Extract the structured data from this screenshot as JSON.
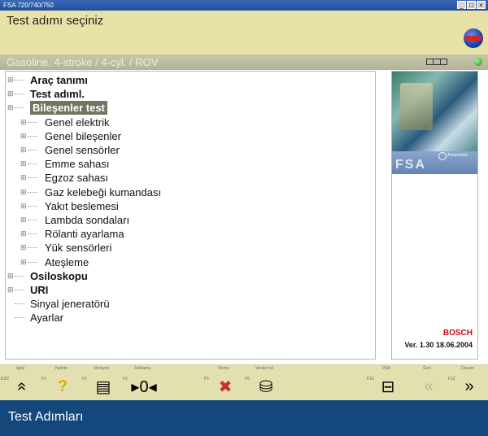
{
  "window": {
    "title": "FSA 720/740/750"
  },
  "header": {
    "title": "Test adımı seçiniz"
  },
  "subheader": {
    "text": "Gasoline, 4-stroke /  4-cyl. / ROV"
  },
  "tree": [
    {
      "label": "Araç tanımı",
      "level": 0,
      "bold": true,
      "expandable": true
    },
    {
      "label": "Test adıml.",
      "level": 0,
      "bold": true,
      "expandable": true
    },
    {
      "label": "Bileşenler test",
      "level": 0,
      "bold": true,
      "expandable": true,
      "selected": true
    },
    {
      "label": "Genel elektrik",
      "level": 1,
      "expandable": true
    },
    {
      "label": "Genel bileşenler",
      "level": 1,
      "expandable": true
    },
    {
      "label": "Genel sensörler",
      "level": 1,
      "expandable": true
    },
    {
      "label": "Emme sahası",
      "level": 1,
      "expandable": true
    },
    {
      "label": "Egzoz sahası",
      "level": 1,
      "expandable": true
    },
    {
      "label": "Gaz kelebeği kumandası",
      "level": 1,
      "expandable": true
    },
    {
      "label": "Yakıt beslemesi",
      "level": 1,
      "expandable": true
    },
    {
      "label": "Lambda sondaları",
      "level": 1,
      "expandable": true
    },
    {
      "label": "Rölanti ayarlama",
      "level": 1,
      "expandable": true
    },
    {
      "label": "Yük sensörleri",
      "level": 1,
      "expandable": true
    },
    {
      "label": "Ateşleme",
      "level": 1,
      "expandable": true
    },
    {
      "label": "Osiloskopu",
      "level": 0,
      "bold": true,
      "expandable": true
    },
    {
      "label": "URI",
      "level": 0,
      "bold": true,
      "expandable": true
    },
    {
      "label": "Sinyal jeneratörü",
      "level": 0,
      "bold": false,
      "expandable": false
    },
    {
      "label": "Ayarlar",
      "level": 0,
      "bold": false,
      "expandable": false
    }
  ],
  "side": {
    "product": "FSA",
    "automotive": "Automotive",
    "brand": "BOSCH",
    "version": "Ver. 1.30 18.06.2004"
  },
  "fkeys": [
    {
      "top": "İptal",
      "f": "ESC",
      "icon": "double-chevron-up-icon",
      "glyph": "«",
      "enabled": true
    },
    {
      "top": "Yardım",
      "f": "F1",
      "icon": "help-question-icon",
      "glyph": "?",
      "enabled": true
    },
    {
      "top": "Versiyon",
      "f": "F2",
      "icon": "document-icon",
      "glyph": "▤",
      "enabled": true
    },
    {
      "top": "Sıfırlama",
      "f": "F3",
      "icon": "reset-zero-icon",
      "glyph": "▸0◂",
      "enabled": true
    },
    {
      "top": "",
      "f": "",
      "icon": "empty",
      "glyph": "",
      "enabled": false
    },
    {
      "top": "Demo",
      "f": "F5",
      "icon": "demo-car-icon",
      "glyph": "✖",
      "enabled": true
    },
    {
      "top": "Verileri sil",
      "f": "F6",
      "icon": "delete-data-icon",
      "glyph": "⛁",
      "enabled": true
    },
    {
      "top": "",
      "f": "",
      "icon": "empty",
      "glyph": "",
      "enabled": false
    },
    {
      "top": "",
      "f": "",
      "icon": "empty",
      "glyph": "",
      "enabled": false
    },
    {
      "top": "DSA",
      "f": "F10",
      "icon": "dsa-icon",
      "glyph": "⊟",
      "enabled": true
    },
    {
      "top": "Geri",
      "f": "",
      "icon": "back-chevron-icon",
      "glyph": "«",
      "enabled": false
    },
    {
      "top": "Devam",
      "f": "F12",
      "icon": "forward-chevron-icon",
      "glyph": "»",
      "enabled": true
    }
  ],
  "caption": {
    "text": "Test Adımları"
  },
  "colors": {
    "header": "#e8e2a6",
    "subbar": "#b8b89c",
    "selection": "#747462",
    "caption": "#14487c",
    "brand": "#d0021b"
  }
}
